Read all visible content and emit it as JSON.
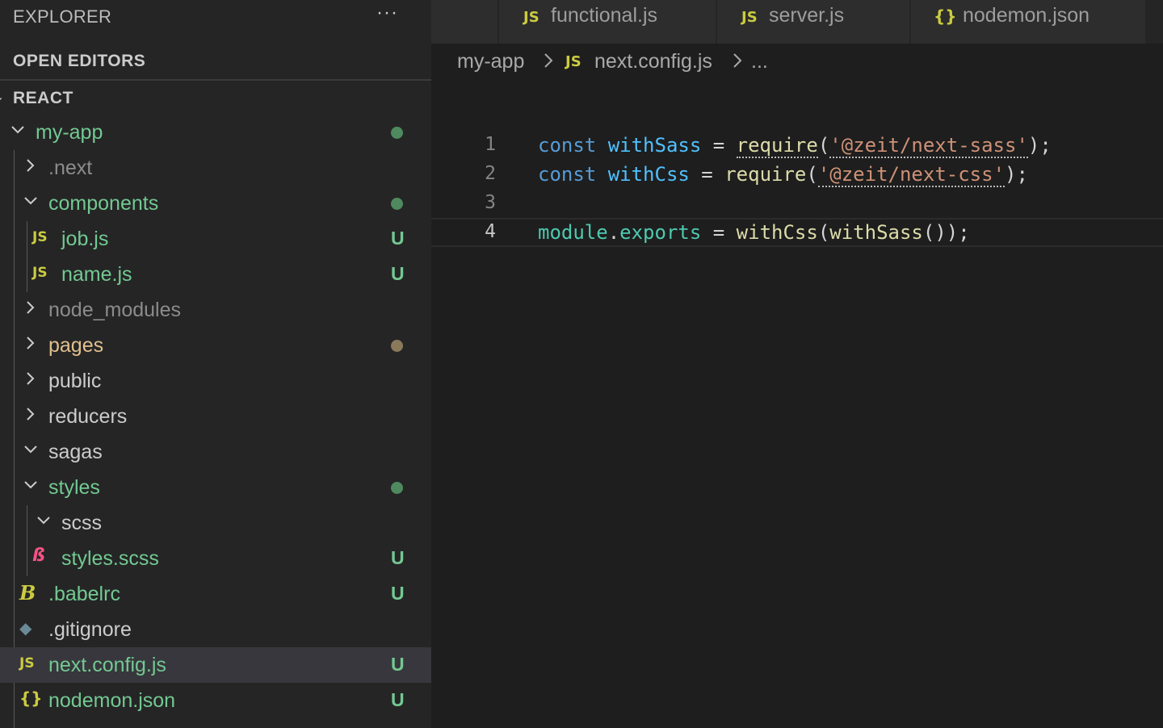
{
  "explorer": {
    "title": "EXPLORER",
    "more": "···"
  },
  "sections": {
    "open_editors": "OPEN EDITORS",
    "react": "REACT"
  },
  "tree": [
    {
      "name": "my-app",
      "depth": 0,
      "kind": "folder-open",
      "color": "#73c991",
      "status": "dot",
      "status_color": "#4e8a5d",
      "icon": "chevron-down-icon"
    },
    {
      "name": ".next",
      "depth": 1,
      "kind": "folder",
      "color": "#8c8c8c",
      "status": "",
      "icon": "chevron-right-icon"
    },
    {
      "name": "components",
      "depth": 1,
      "kind": "folder-open",
      "color": "#73c991",
      "status": "dot",
      "status_color": "#4e8a5d",
      "icon": "chevron-down-icon"
    },
    {
      "name": "job.js",
      "depth": 2,
      "kind": "js",
      "color": "#73c991",
      "status": "U",
      "icon": "js-file-icon",
      "glyph": "JS"
    },
    {
      "name": "name.js",
      "depth": 2,
      "kind": "js",
      "color": "#73c991",
      "status": "U",
      "icon": "js-file-icon",
      "glyph": "JS"
    },
    {
      "name": "node_modules",
      "depth": 1,
      "kind": "folder",
      "color": "#8c8c8c",
      "status": "",
      "icon": "chevron-right-icon"
    },
    {
      "name": "pages",
      "depth": 1,
      "kind": "folder",
      "color": "#e2c08d",
      "status": "dot",
      "status_color": "#8a7a5a",
      "icon": "chevron-right-icon"
    },
    {
      "name": "public",
      "depth": 1,
      "kind": "folder",
      "color": "#cccccc",
      "status": "",
      "icon": "chevron-right-icon"
    },
    {
      "name": "reducers",
      "depth": 1,
      "kind": "folder",
      "color": "#cccccc",
      "status": "",
      "icon": "chevron-right-icon"
    },
    {
      "name": "sagas",
      "depth": 1,
      "kind": "folder-open",
      "color": "#cccccc",
      "status": "",
      "icon": "chevron-down-icon"
    },
    {
      "name": "styles",
      "depth": 1,
      "kind": "folder-open",
      "color": "#73c991",
      "status": "dot",
      "status_color": "#4e8a5d",
      "icon": "chevron-down-icon"
    },
    {
      "name": "scss",
      "depth": 2,
      "kind": "folder-open",
      "color": "#cccccc",
      "status": "",
      "icon": "chevron-down-icon"
    },
    {
      "name": "styles.scss",
      "depth": 2,
      "kind": "scss",
      "color": "#73c991",
      "status": "U",
      "icon": "sass-file-icon",
      "glyph": "ß"
    },
    {
      "name": ".babelrc",
      "depth": 1,
      "kind": "babel",
      "color": "#73c991",
      "status": "U",
      "icon": "babel-file-icon",
      "glyph": "B"
    },
    {
      "name": ".gitignore",
      "depth": 1,
      "kind": "git",
      "color": "#cccccc",
      "status": "",
      "icon": "git-file-icon",
      "glyph": "◆"
    },
    {
      "name": "next.config.js",
      "depth": 1,
      "kind": "js",
      "color": "#73c991",
      "status": "U",
      "icon": "js-file-icon",
      "glyph": "JS",
      "selected": true
    },
    {
      "name": "nodemon.json",
      "depth": 1,
      "kind": "json",
      "color": "#73c991",
      "status": "U",
      "icon": "json-file-icon",
      "glyph": "{}"
    }
  ],
  "tabs": [
    {
      "label": "functional.js",
      "icon": "js-file-icon",
      "glyph": "JS"
    },
    {
      "label": "server.js",
      "icon": "js-file-icon",
      "glyph": "JS"
    },
    {
      "label": "nodemon.json",
      "icon": "json-file-icon",
      "glyph": "{}"
    }
  ],
  "breadcrumb": {
    "folder": "my-app",
    "file_icon": "JS",
    "file": "next.config.js",
    "more": "..."
  },
  "code": {
    "line_numbers": [
      "1",
      "2",
      "3",
      "4"
    ],
    "l1": {
      "kw": "const",
      "name": "withSass",
      "eq": " = ",
      "fn": "require",
      "open": "(",
      "str": "'@zeit/next-sass'",
      "close": ");"
    },
    "l2": {
      "kw": "const",
      "name": "withCss",
      "eq": " = ",
      "fn": "require",
      "open": "(",
      "str": "'@zeit/next-css'",
      "close": ");"
    },
    "l4": {
      "obj": "module",
      "dot": ".",
      "prop": "exports",
      "eq": " = ",
      "fn1": "withCss",
      "p1": "(",
      "fn2": "withSass",
      "p2": "());"
    }
  },
  "colors": {
    "accent_green": "#73c991",
    "js_yellow": "#cbcb41",
    "editor_bg": "#1e1e1e",
    "sidebar_bg": "#252526"
  }
}
